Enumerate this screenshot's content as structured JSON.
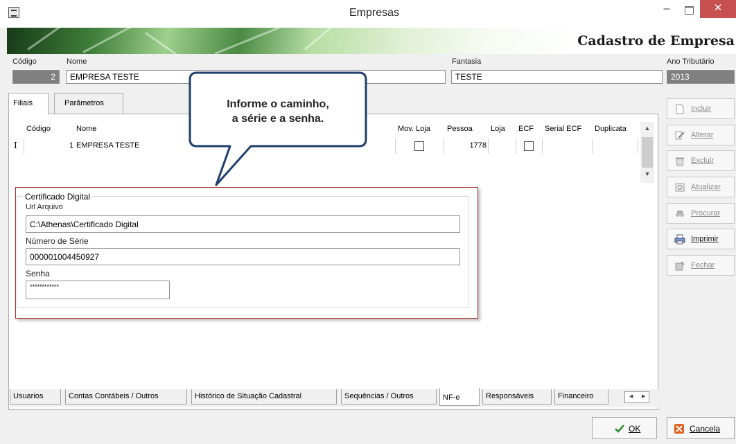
{
  "window": {
    "title": "Empresas",
    "minimize": "–",
    "close": "✕"
  },
  "banner": {
    "title": "Cadastro de Empresa"
  },
  "header": {
    "codigo_label": "Código",
    "codigo_value": "2",
    "nome_label": "Nome",
    "nome_value": "EMPRESA TESTE",
    "fantasia_label": "Fantasia",
    "fantasia_value": "TESTE",
    "ano_label": "Ano Tributário",
    "ano_value": "2013"
  },
  "top_tabs": [
    "Filiais",
    "Parâmetros"
  ],
  "grid": {
    "columns": [
      "Código",
      "Nome",
      "Mov. Loja",
      "Pessoa",
      "Loja",
      "ECF",
      "Serial ECF",
      "Duplicata"
    ],
    "row": {
      "indicator": "I",
      "codigo": "1",
      "nome": "EMPRESA TESTE",
      "pessoa": "1778"
    }
  },
  "callout": {
    "line1": "Informe o caminho,",
    "line2": "a série e a senha."
  },
  "certificado": {
    "legend": "Certificado Digital",
    "url_label": "Url Arquivo",
    "url_value": "C:\\Athenas\\Certificado Digital",
    "serie_label": "Número de Série",
    "serie_value": "000001004450927",
    "senha_label": "Senha",
    "senha_value": "************"
  },
  "bottom_tabs": [
    "Usuarios",
    "Contas Contábeis / Outros",
    "Histórico de Situação Cadastral",
    "Sequências / Outros",
    "NF-e",
    "Responsáveis",
    "Financeiro"
  ],
  "side_buttons": {
    "incluir": "Incluir",
    "alterar": "Alterar",
    "excluir": "Excluir",
    "atualizar": "Atualizar",
    "procurar": "Procurar",
    "imprimir": "Imprimir",
    "fechar": "Fechar"
  },
  "actions": {
    "ok": "OK",
    "cancelar": "Cancela"
  },
  "colors": {
    "accent_green": "#2e8b2e",
    "callout_border": "#1f3f6f",
    "highlight_frame": "#b02a2a",
    "close_red": "#c75050"
  }
}
